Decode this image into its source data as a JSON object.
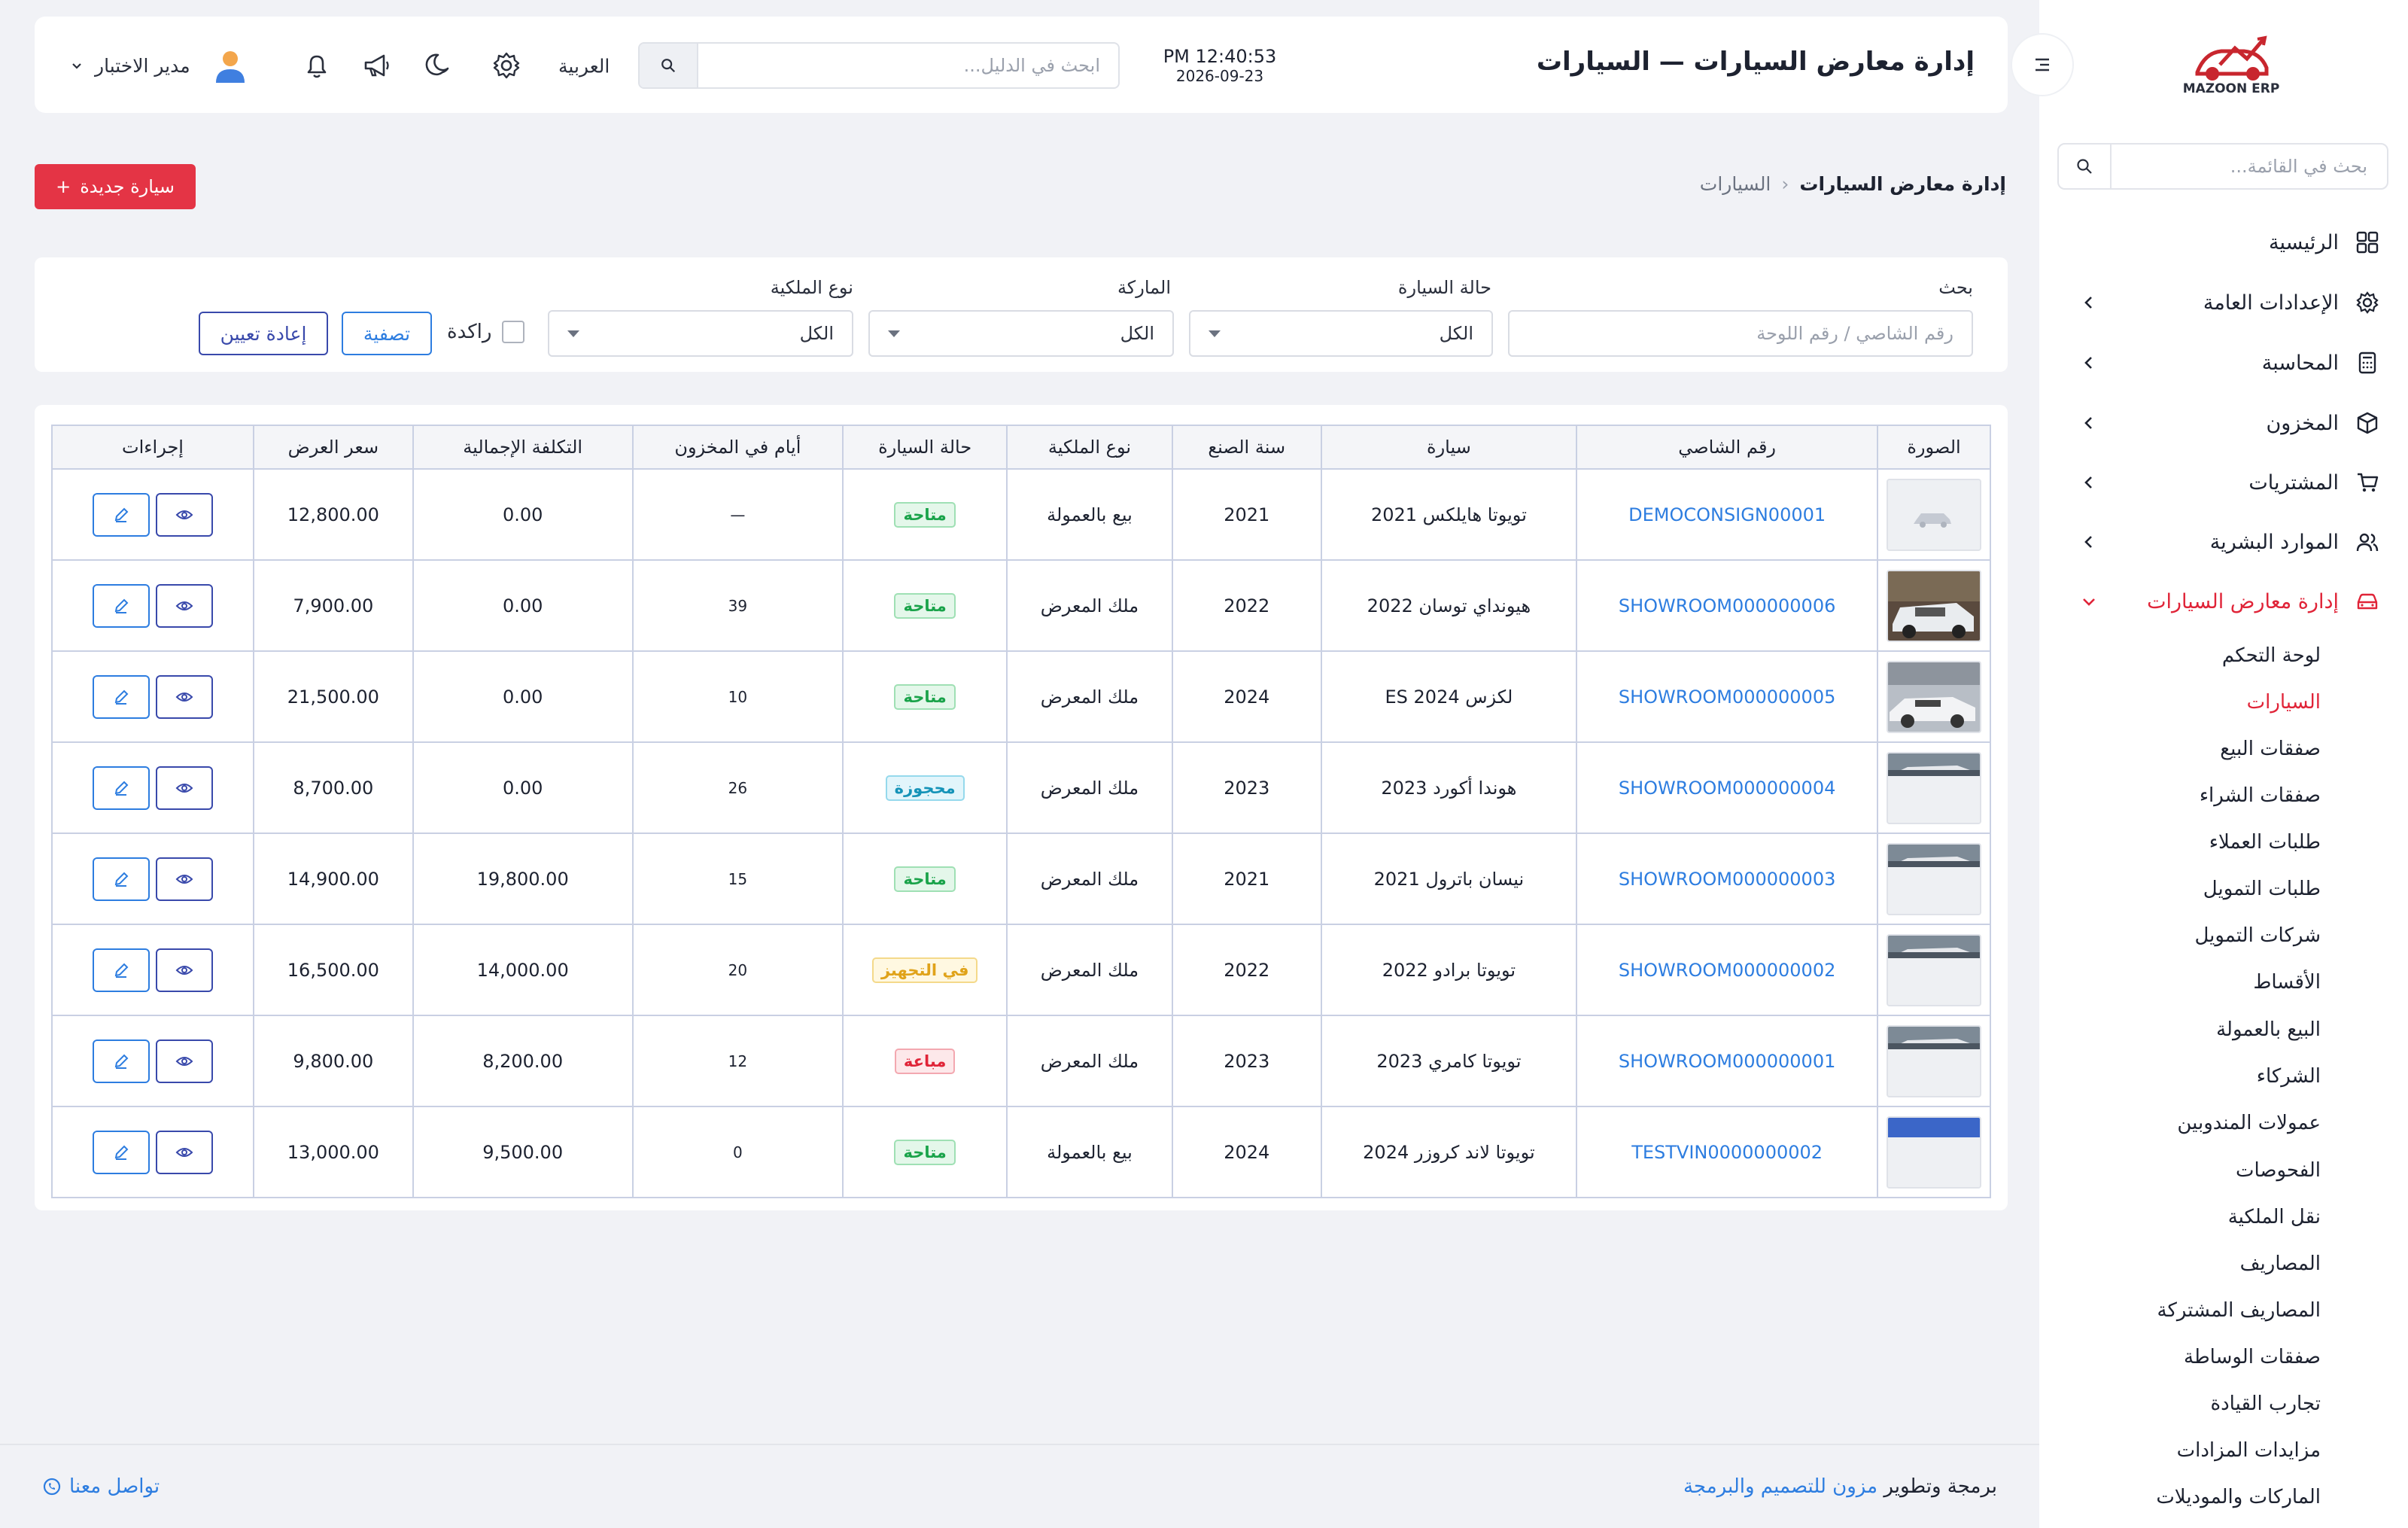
{
  "app": {
    "logo_text": "MAZOON ERP"
  },
  "sidebar": {
    "search_placeholder": "بحث في القائمة...",
    "items": [
      {
        "label": "الرئيسية",
        "icon": "grid-icon",
        "expandable": false
      },
      {
        "label": "الإعدادات العامة",
        "icon": "gear-icon",
        "expandable": true
      },
      {
        "label": "المحاسبة",
        "icon": "calculator-icon",
        "expandable": true
      },
      {
        "label": "المخزون",
        "icon": "box-icon",
        "expandable": true
      },
      {
        "label": "المشتريات",
        "icon": "cart-icon",
        "expandable": true
      },
      {
        "label": "الموارد البشرية",
        "icon": "users-icon",
        "expandable": true
      },
      {
        "label": "إدارة معارض السيارات",
        "icon": "car-icon",
        "expandable": true,
        "active": true
      }
    ],
    "sub_items": [
      {
        "label": "لوحة التحكم"
      },
      {
        "label": "السيارات",
        "active": true
      },
      {
        "label": "صفقات البيع"
      },
      {
        "label": "صفقات الشراء"
      },
      {
        "label": "طلبات العملاء"
      },
      {
        "label": "طلبات التمويل"
      },
      {
        "label": "شركات التمويل"
      },
      {
        "label": "الأقساط"
      },
      {
        "label": "البيع بالعمولة"
      },
      {
        "label": "الشركاء"
      },
      {
        "label": "عمولات المندوبين"
      },
      {
        "label": "الفحوصات"
      },
      {
        "label": "نقل الملكية"
      },
      {
        "label": "المصاريف"
      },
      {
        "label": "المصاريف المشتركة"
      },
      {
        "label": "صفقات الوساطة"
      },
      {
        "label": "تجارب القيادة"
      },
      {
        "label": "مزايدات المزادات"
      },
      {
        "label": "الماركات والموديلات"
      }
    ]
  },
  "header": {
    "title": "إدارة معارض السيارات — السيارات",
    "time": "PM 12:40:53",
    "date": "2026-09-23",
    "search_placeholder": "ابحث في الدليل...",
    "language": "العربية",
    "user_name": "مدير الاختبار"
  },
  "breadcrumb": {
    "root": "إدارة معارض السيارات",
    "current": "السيارات"
  },
  "actions": {
    "new_car": "سيارة جديدة",
    "new_car_plus": "+"
  },
  "filters": {
    "search_label": "بحث",
    "search_placeholder": "رقم الشاصي / رقم اللوحة",
    "status_label": "حالة السيارة",
    "status_value": "الكل",
    "brand_label": "الماركة",
    "brand_value": "الكل",
    "ownership_label": "نوع الملكية",
    "ownership_value": "الكل",
    "stale_label": "راكدة",
    "filter_button": "تصفية",
    "reset_button": "إعادة تعيين"
  },
  "table": {
    "headers": [
      "الصورة",
      "رقم الشاصي",
      "سيارة",
      "سنة الصنع",
      "نوع الملكية",
      "حالة السيارة",
      "أيام في المخزون",
      "التكلفة الإجمالية",
      "سعر العرض",
      "إجراءات"
    ],
    "rows": [
      {
        "vin": "DEMOCONSIGN00001",
        "car": "تويوتا هايلكس 2021",
        "year": "2021",
        "ownership": "بيع بالعمولة",
        "status": "متاحة",
        "status_color": "#1aa34a",
        "days": "—",
        "cost": "0.00",
        "price": "12,800.00",
        "thumb": "placeholder"
      },
      {
        "vin": "SHOWROOM000000006",
        "car": "هيونداي توسان 2022",
        "year": "2022",
        "ownership": "ملك المعرض",
        "status": "متاحة",
        "status_color": "#1aa34a",
        "days": "39",
        "cost": "0.00",
        "price": "7,900.00",
        "thumb": "white-suv"
      },
      {
        "vin": "SHOWROOM000000005",
        "car": "لكزس ES 2024",
        "year": "2024",
        "ownership": "ملك المعرض",
        "status": "متاحة",
        "status_color": "#1aa34a",
        "days": "10",
        "cost": "0.00",
        "price": "21,500.00",
        "thumb": "white-sedan"
      },
      {
        "vin": "SHOWROOM000000004",
        "car": "هوندا أكورد 2023",
        "year": "2023",
        "ownership": "ملك المعرض",
        "status": "محجوزة",
        "status_color": "#1593b8",
        "days": "26",
        "cost": "0.00",
        "price": "8,700.00",
        "thumb": "partial"
      },
      {
        "vin": "SHOWROOM000000003",
        "car": "نيسان باترول 2021",
        "year": "2021",
        "ownership": "ملك المعرض",
        "status": "متاحة",
        "status_color": "#1aa34a",
        "days": "15",
        "cost": "19,800.00",
        "price": "14,900.00",
        "thumb": "partial"
      },
      {
        "vin": "SHOWROOM000000002",
        "car": "تويوتا برادو 2022",
        "year": "2022",
        "ownership": "ملك المعرض",
        "status": "في التجهيز",
        "status_color": "#e0a31a",
        "days": "20",
        "cost": "14,000.00",
        "price": "16,500.00",
        "thumb": "partial"
      },
      {
        "vin": "SHOWROOM000000001",
        "car": "تويوتا كامري 2023",
        "year": "2023",
        "ownership": "ملك المعرض",
        "status": "مباعة",
        "status_color": "#e02438",
        "days": "12",
        "cost": "8,200.00",
        "price": "9,800.00",
        "thumb": "partial"
      },
      {
        "vin": "TESTVIN0000000002",
        "car": "تويوتا لاند كروزر 2024",
        "year": "2024",
        "ownership": "بيع بالعمولة",
        "status": "متاحة",
        "status_color": "#1aa34a",
        "days": "0",
        "cost": "9,500.00",
        "price": "13,000.00",
        "thumb": "blue-banner"
      }
    ]
  },
  "footer": {
    "prefix": "برمجة وتطوير",
    "brand": "مزون للتصميم والبرمجة",
    "contact": "تواصل معنا"
  },
  "colors": {
    "accent": "#e02438",
    "link": "#2d7de0",
    "primary_button": "#e43445"
  }
}
